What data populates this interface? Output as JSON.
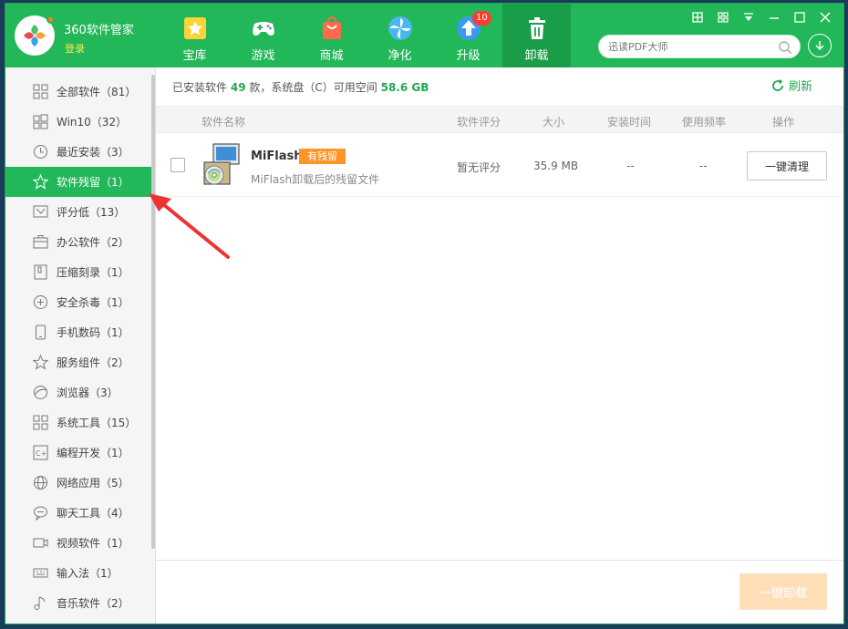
{
  "app": {
    "title": "360软件管家",
    "login": "登录"
  },
  "nav": [
    {
      "label": "宝库",
      "icon": "star-treasure-icon"
    },
    {
      "label": "游戏",
      "icon": "gamepad-icon"
    },
    {
      "label": "商城",
      "icon": "shopping-bag-icon"
    },
    {
      "label": "净化",
      "icon": "fan-clean-icon"
    },
    {
      "label": "升级",
      "icon": "upgrade-arrow-icon",
      "badge": "10"
    },
    {
      "label": "卸载",
      "icon": "trash-icon",
      "active": true
    }
  ],
  "search": {
    "placeholder": "迅读PDF大师"
  },
  "sidebar": {
    "items": [
      {
        "label": "全部软件（81）",
        "icon": "grid-icon"
      },
      {
        "label": "Win10（32）",
        "icon": "windows-icon"
      },
      {
        "label": "最近安装（3）",
        "icon": "clock-icon"
      },
      {
        "label": "软件残留（1）",
        "icon": "star-icon",
        "active": true
      },
      {
        "label": "评分低（13）",
        "icon": "thumb-down-icon"
      },
      {
        "label": "办公软件（2）",
        "icon": "briefcase-icon"
      },
      {
        "label": "压缩刻录（1）",
        "icon": "archive-icon"
      },
      {
        "label": "安全杀毒（1）",
        "icon": "shield-plus-icon"
      },
      {
        "label": "手机数码（1）",
        "icon": "phone-icon"
      },
      {
        "label": "服务组件（2）",
        "icon": "star-outline-icon"
      },
      {
        "label": "浏览器（3）",
        "icon": "browser-icon"
      },
      {
        "label": "系统工具（15）",
        "icon": "tools-grid-icon"
      },
      {
        "label": "编程开发（1）",
        "icon": "code-icon"
      },
      {
        "label": "网络应用（5）",
        "icon": "globe-icon"
      },
      {
        "label": "聊天工具（4）",
        "icon": "chat-icon"
      },
      {
        "label": "视频软件（1）",
        "icon": "video-icon"
      },
      {
        "label": "输入法（1）",
        "icon": "keyboard-icon"
      },
      {
        "label": "音乐软件（2）",
        "icon": "music-icon"
      }
    ]
  },
  "summary": {
    "prefix": "已安装软件",
    "count": "49",
    "mid": "款，系统盘（C）可用空间",
    "free_space": "58.6 GB"
  },
  "refresh_label": "刷新",
  "table": {
    "headers": {
      "name": "软件名称",
      "rating": "软件评分",
      "size": "大小",
      "install_time": "安装时间",
      "usage": "使用频率",
      "action": "操作"
    },
    "rows": [
      {
        "name": "MiFlash",
        "tag": "有残留",
        "desc": "MiFlash卸载后的残留文件",
        "rating": "暂无评分",
        "size": "35.9 MB",
        "install_time": "--",
        "usage": "--",
        "action": "一键清理"
      }
    ]
  },
  "footer": {
    "uninstall_label": "一键卸载"
  },
  "colors": {
    "brand": "#22b758",
    "accent": "#ff9428",
    "badge": "#ff3b30"
  }
}
